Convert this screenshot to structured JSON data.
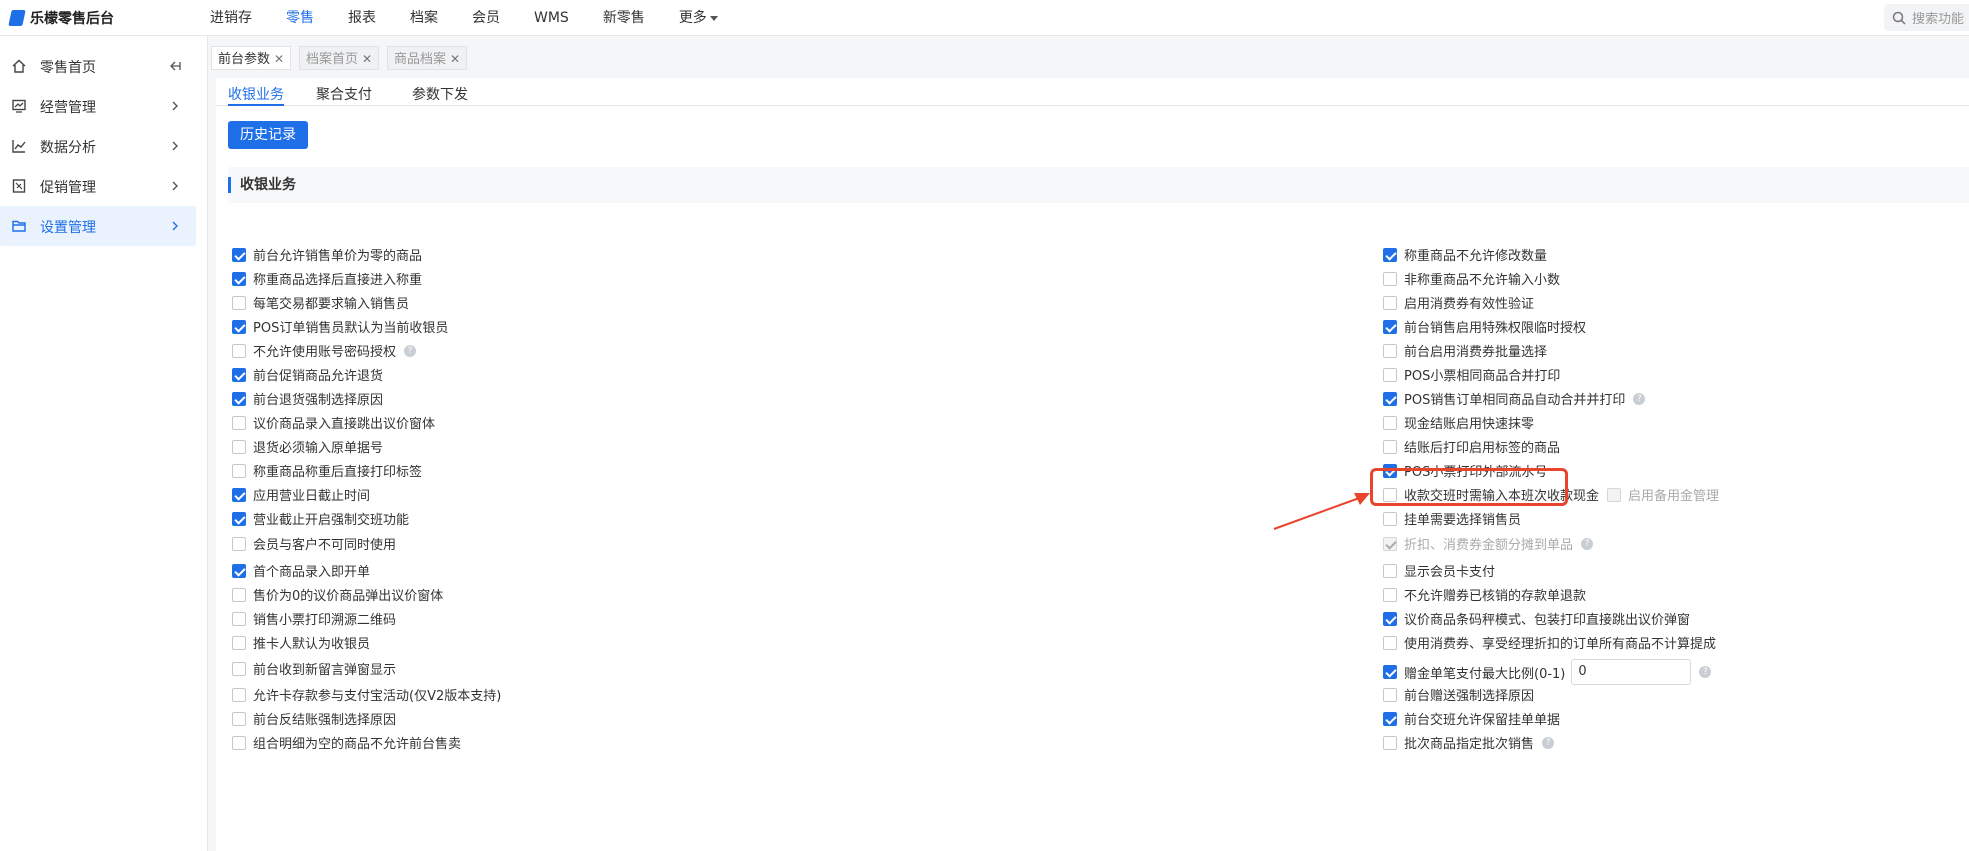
{
  "app": {
    "title": "乐檬零售后台"
  },
  "topnav": [
    {
      "label": "进销存",
      "active": false
    },
    {
      "label": "零售",
      "active": true
    },
    {
      "label": "报表",
      "active": false
    },
    {
      "label": "档案",
      "active": false
    },
    {
      "label": "会员",
      "active": false
    },
    {
      "label": "WMS",
      "active": false
    },
    {
      "label": "新零售",
      "active": false
    },
    {
      "label": "更多",
      "active": false
    }
  ],
  "search": {
    "placeholder": "搜索功能"
  },
  "sidebar": {
    "items": [
      {
        "label": "零售首页",
        "icon": "home-icon"
      },
      {
        "label": "经营管理",
        "icon": "monitor-icon"
      },
      {
        "label": "数据分析",
        "icon": "chart-icon"
      },
      {
        "label": "促销管理",
        "icon": "promotion-icon"
      },
      {
        "label": "设置管理",
        "icon": "folder-icon"
      }
    ]
  },
  "page_tabs": [
    {
      "label": "前台参数",
      "active": true
    },
    {
      "label": "档案首页",
      "active": false
    },
    {
      "label": "商品档案",
      "active": false
    }
  ],
  "sub_tabs": [
    "收银业务",
    "聚合支付",
    "参数下发"
  ],
  "history_button": "历史记录",
  "section_title": "收银业务",
  "left_options": [
    {
      "label": "前台允许销售单价为零的商品",
      "checked": true
    },
    {
      "label": "称重商品选择后直接进入称重",
      "checked": true
    },
    {
      "label": "每笔交易都要求输入销售员",
      "checked": false
    },
    {
      "label": "POS订单销售员默认为当前收银员",
      "checked": true
    },
    {
      "label": "不允许使用账号密码授权",
      "checked": false,
      "help": true
    },
    {
      "label": "前台促销商品允许退货",
      "checked": true
    },
    {
      "label": "前台退货强制选择原因",
      "checked": true
    },
    {
      "label": "议价商品录入直接跳出议价窗体",
      "checked": false
    },
    {
      "label": "退货必须输入原单据号",
      "checked": false
    },
    {
      "label": "称重商品称重后直接打印标签",
      "checked": false
    },
    {
      "label": "应用营业日截止时间",
      "checked": true
    },
    {
      "label": "营业截止开启强制交班功能",
      "checked": true
    },
    {
      "label": "会员与客户不可同时使用",
      "checked": false
    },
    {
      "label": "首个商品录入即开单",
      "checked": true
    },
    {
      "label": "售价为0的议价商品弹出议价窗体",
      "checked": false
    },
    {
      "label": "销售小票打印溯源二维码",
      "checked": false
    },
    {
      "label": "推卡人默认为收银员",
      "checked": false
    },
    {
      "label": "前台收到新留言弹窗显示",
      "checked": false
    },
    {
      "label": "允许卡存款参与支付宝活动(仅V2版本支持)",
      "checked": false
    },
    {
      "label": "前台反结账强制选择原因",
      "checked": false
    },
    {
      "label": "组合明细为空的商品不允许前台售卖",
      "checked": false
    }
  ],
  "right_options": [
    {
      "label": "称重商品不允许修改数量",
      "checked": true
    },
    {
      "label": "非称重商品不允许输入小数",
      "checked": false
    },
    {
      "label": "启用消费券有效性验证",
      "checked": false
    },
    {
      "label": "前台销售启用特殊权限临时授权",
      "checked": true
    },
    {
      "label": "前台启用消费券批量选择",
      "checked": false
    },
    {
      "label": "POS小票相同商品合并打印",
      "checked": false
    },
    {
      "label": "POS销售订单相同商品自动合并并打印",
      "checked": true,
      "help": true
    },
    {
      "label": "现金结账启用快速抹零",
      "checked": false
    },
    {
      "label": "结账后打印启用标签的商品",
      "checked": false
    },
    {
      "label": "POS小票打印外部流水号",
      "checked": true
    },
    {
      "label": "收款交班时需输入本班次收款现金",
      "checked": false,
      "sub": "启用备用金管理"
    },
    {
      "label": "挂单需要选择销售员",
      "checked": false
    },
    {
      "label": "折扣、消费券金额分摊到单品",
      "checked": true,
      "disabled": true,
      "help": true
    },
    {
      "label": "显示会员卡支付",
      "checked": false
    },
    {
      "label": "不允许赠券已核销的存款单退款",
      "checked": false
    },
    {
      "label": "议价商品条码秤模式、包装打印直接跳出议价弹窗",
      "checked": true
    },
    {
      "label": "使用消费券、享受经理折扣的订单所有商品不计算提成",
      "checked": false
    },
    {
      "label": "赠金单笔支付最大比例(0-1)",
      "checked": true,
      "input": "0",
      "help": true
    },
    {
      "label": "前台赠送强制选择原因",
      "checked": false
    },
    {
      "label": "前台交班允许保留挂单单据",
      "checked": true
    },
    {
      "label": "批次商品指定批次销售",
      "checked": false,
      "help": true
    }
  ],
  "colors": {
    "accent": "#1f6fe8",
    "highlight": "#e8452c"
  }
}
